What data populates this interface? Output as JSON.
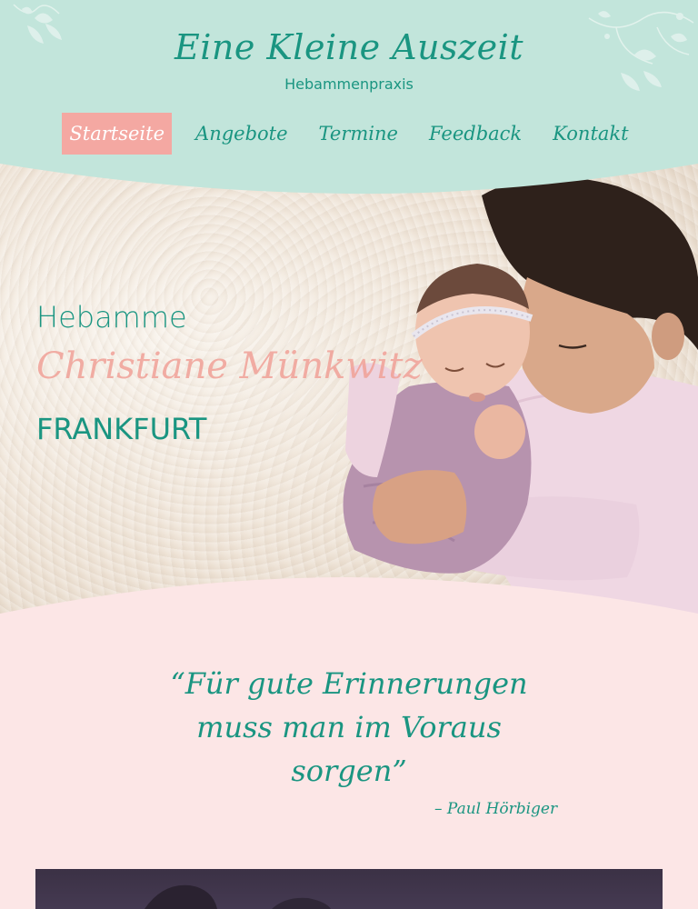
{
  "header": {
    "title": "Eine Kleine Auszeit",
    "subtitle": "Hebammenpraxis"
  },
  "nav": {
    "items": [
      {
        "label": "Startseite",
        "active": true
      },
      {
        "label": "Angebote"
      },
      {
        "label": "Termine"
      },
      {
        "label": "Feedback"
      },
      {
        "label": "Kontakt"
      }
    ]
  },
  "hero": {
    "label": "Hebamme",
    "name": "Christiane Münkwitz",
    "city": "FRANKFURT"
  },
  "quote": {
    "lines": [
      "“Für gute Erinnerungen",
      "muss man im Voraus",
      "sorgen”"
    ],
    "author": "– Paul Hörbiger"
  },
  "colors": {
    "mint": "#c2e5db",
    "teal": "#1a9581",
    "coral": "#f4a8a2",
    "pink_bg": "#fce6e6"
  },
  "icons": {
    "floral_left": "floral-ornament-icon",
    "floral_right": "floral-ornament-icon"
  }
}
